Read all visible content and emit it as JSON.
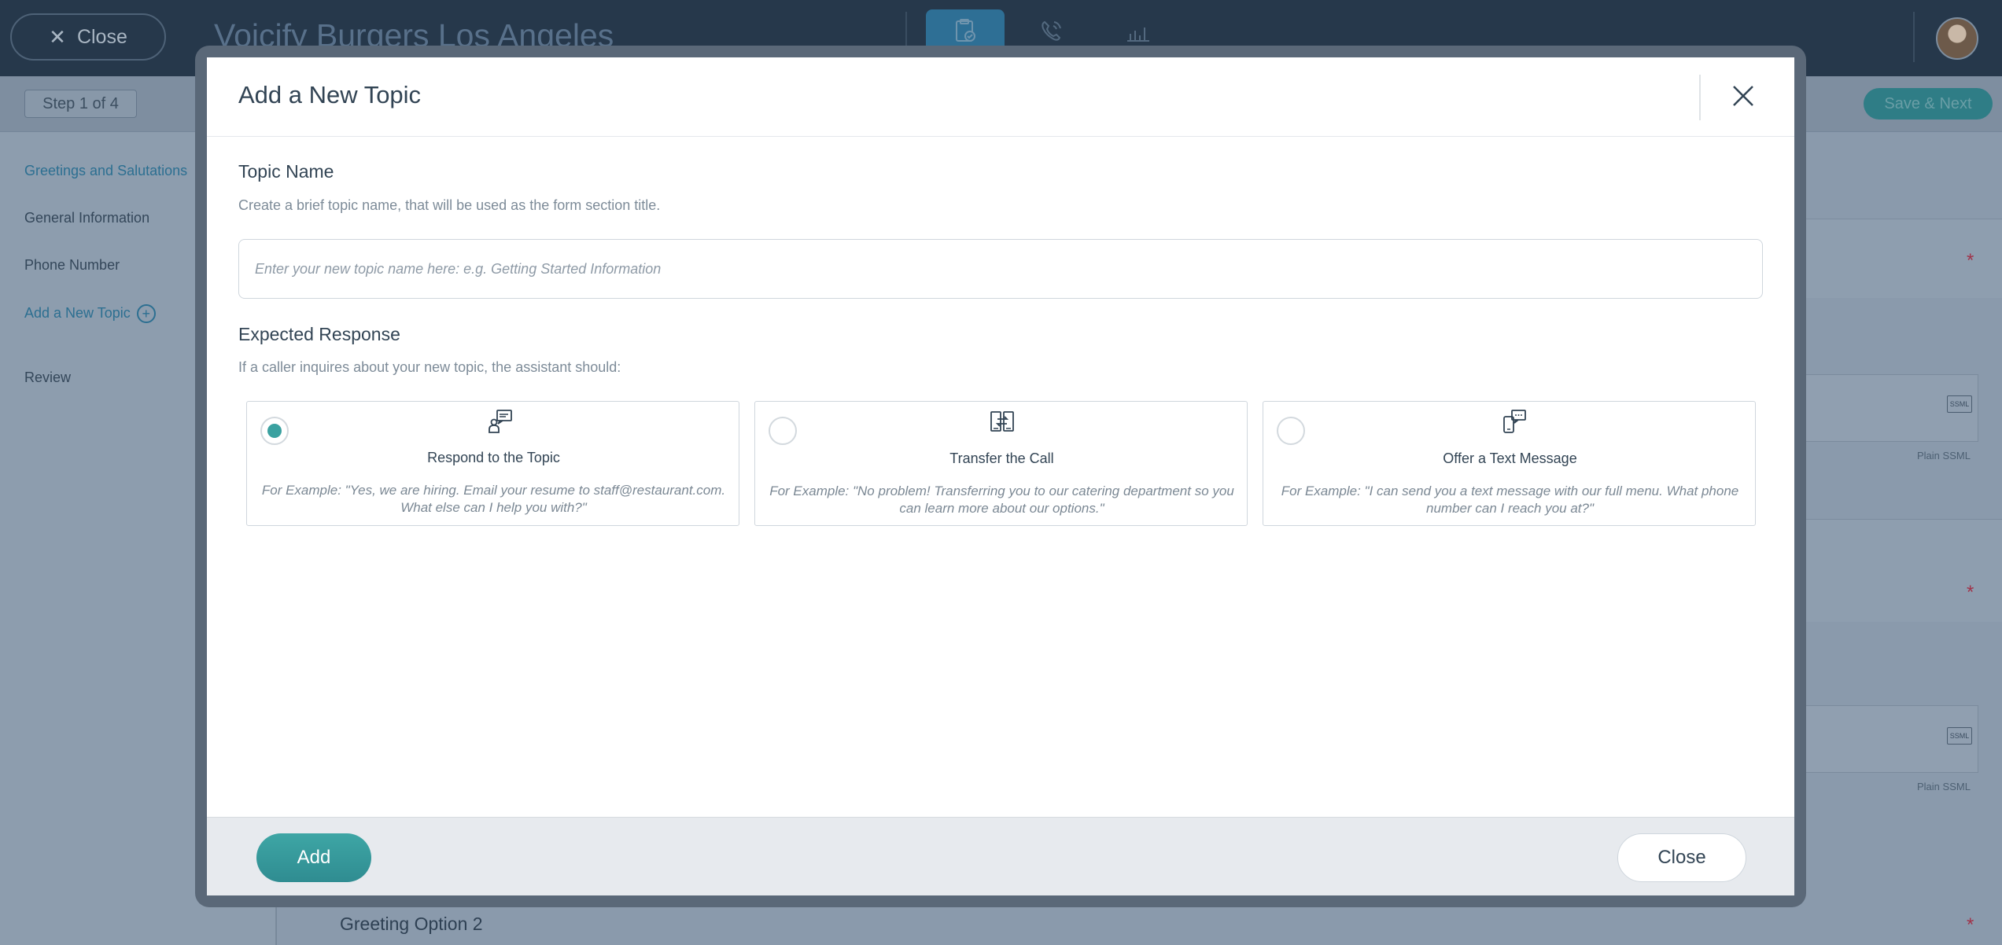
{
  "background": {
    "close_label": "Close",
    "app_title": "Voicify Burgers Los Angeles",
    "step_badge": "Step 1 of 4",
    "save_next_label": "Save & Next",
    "sidebar_items": [
      {
        "label": "Greetings and Salutations",
        "active": true
      },
      {
        "label": "General Information",
        "active": false
      },
      {
        "label": "Phone Number",
        "active": false
      },
      {
        "label": "Add a New Topic",
        "active": false
      },
      {
        "label": "Review",
        "active": false
      }
    ],
    "ssml_tag": "SSML",
    "plain_ssml": "Plain SSML",
    "required_mark": "*",
    "greeting_option_2": "Greeting Option 2"
  },
  "modal": {
    "title": "Add a New Topic",
    "topic_name": {
      "title": "Topic Name",
      "help": "Create a brief topic name, that will be used as the form section title.",
      "value": "",
      "placeholder": "Enter your new topic name here: e.g. Getting Started Information"
    },
    "expected_response": {
      "title": "Expected Response",
      "help": "If a caller inquires about your new topic, the assistant should:",
      "options": [
        {
          "label": "Respond to the Topic",
          "icon": "chat-person-icon",
          "selected": true,
          "example": "For Example: \"Yes, we are hiring. Email your resume to staff@restaurant.com. What else can I help you with?\""
        },
        {
          "label": "Transfer the Call",
          "icon": "transfer-icon",
          "selected": false,
          "example": "For Example: \"No problem! Transferring you to our catering department so you can learn more about our options.\""
        },
        {
          "label": "Offer a Text Message",
          "icon": "phone-message-icon",
          "selected": false,
          "example": "For Example: \"I can send you a text message with our full menu. What phone number can I reach you at?\""
        }
      ]
    },
    "footer": {
      "add_label": "Add",
      "close_label": "Close"
    }
  },
  "colors": {
    "accent": "#3aa1a0",
    "header_bg": "#26384b",
    "text": "#324454"
  }
}
